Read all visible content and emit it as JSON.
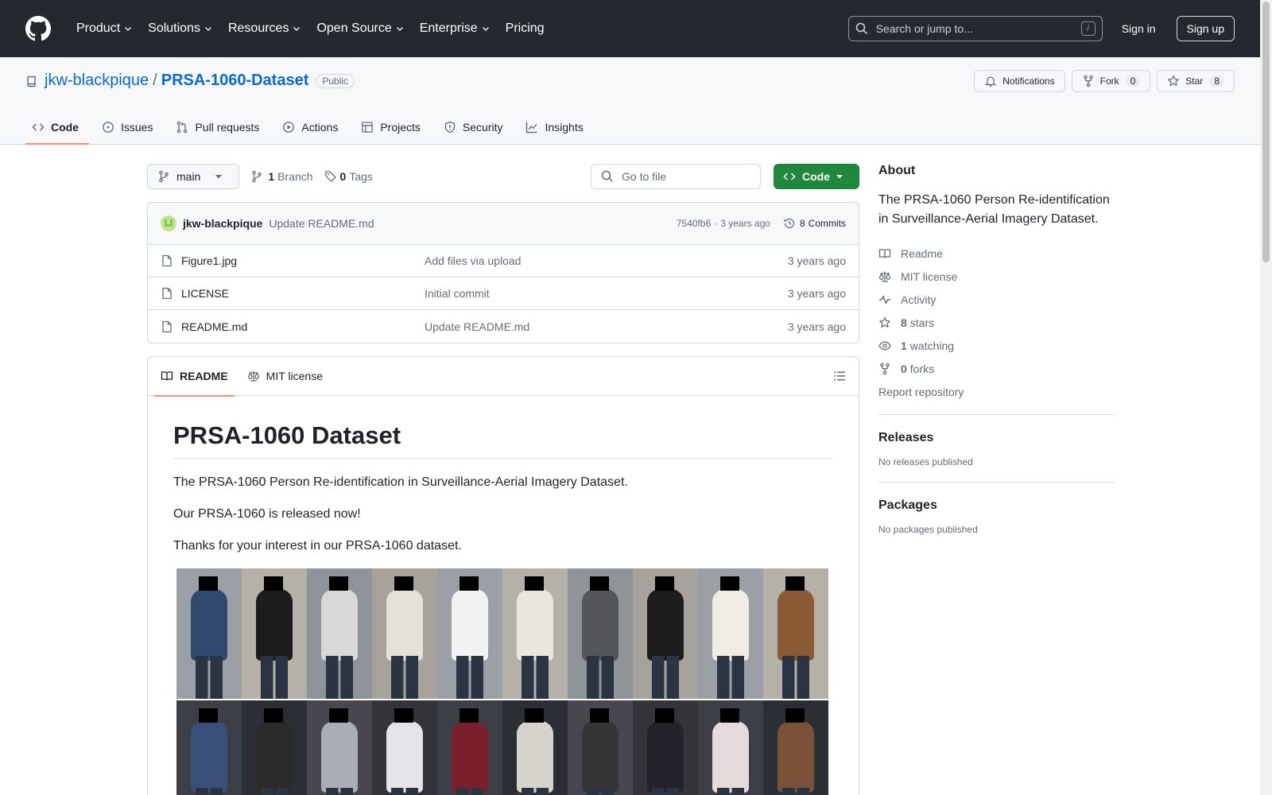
{
  "header": {
    "nav": [
      {
        "label": "Product",
        "has_caret": true
      },
      {
        "label": "Solutions",
        "has_caret": true
      },
      {
        "label": "Resources",
        "has_caret": true
      },
      {
        "label": "Open Source",
        "has_caret": true
      },
      {
        "label": "Enterprise",
        "has_caret": true
      },
      {
        "label": "Pricing",
        "has_caret": false
      }
    ],
    "search_placeholder": "Search or jump to...",
    "search_shortcut": "/",
    "signin_label": "Sign in",
    "signup_label": "Sign up"
  },
  "repo": {
    "owner": "jkw-blackpique",
    "separator": "/",
    "name": "PRSA-1060-Dataset",
    "visibility": "Public",
    "actions": {
      "notifications_label": "Notifications",
      "fork_label": "Fork",
      "fork_count": "0",
      "star_label": "Star",
      "star_count": "8"
    },
    "tabs": [
      {
        "label": "Code",
        "icon": "code-icon",
        "selected": true
      },
      {
        "label": "Issues",
        "icon": "issue-icon",
        "selected": false
      },
      {
        "label": "Pull requests",
        "icon": "pull-request-icon",
        "selected": false
      },
      {
        "label": "Actions",
        "icon": "play-icon",
        "selected": false
      },
      {
        "label": "Projects",
        "icon": "table-icon",
        "selected": false
      },
      {
        "label": "Security",
        "icon": "shield-icon",
        "selected": false
      },
      {
        "label": "Insights",
        "icon": "graph-icon",
        "selected": false
      }
    ]
  },
  "file_nav": {
    "branch": "main",
    "branch_count": "1",
    "branch_label": "Branch",
    "tag_count": "0",
    "tag_label": "Tags",
    "goto_placeholder": "Go to file",
    "code_label": "Code"
  },
  "latest_commit": {
    "author": "jkw-blackpique",
    "message": "Update README.md",
    "sha": "7540fb6",
    "dot": "·",
    "age": "3 years ago",
    "commits_count": "8",
    "commits_label": "Commits"
  },
  "files": [
    {
      "name": "Figure1.jpg",
      "commit": "Add files via upload",
      "age": "3 years ago"
    },
    {
      "name": "LICENSE",
      "commit": "Initial commit",
      "age": "3 years ago"
    },
    {
      "name": "README.md",
      "commit": "Update README.md",
      "age": "3 years ago"
    }
  ],
  "readme": {
    "tab_readme": "README",
    "tab_license": "MIT license",
    "title": "PRSA-1060 Dataset",
    "paragraphs": [
      "The PRSA-1060 Person Re-identification in Surveillance-Aerial Imagery Dataset.",
      "Our PRSA-1060 is released now!",
      "Thanks for your interest in our PRSA-1060 dataset."
    ],
    "figure_palette": {
      "top": [
        "#2f4a6e",
        "#1c1c1c",
        "#d8d8d8",
        "#e6e1d8",
        "#f2f2f2",
        "#ebe6dc",
        "#55565a",
        "#1d1d1d",
        "#f0ece4",
        "#8a5a34"
      ],
      "bottom": [
        "#3a4f7a",
        "#2a2a2a",
        "#a9adb5",
        "#e4e4ea",
        "#7a1f2b",
        "#d6d2cc",
        "#353535",
        "#22222a",
        "#e7dadc",
        "#7a5038"
      ]
    }
  },
  "sidebar": {
    "about_heading": "About",
    "about_description": "The PRSA-1060 Person Re-identification in Surveillance-Aerial Imagery Dataset.",
    "links": [
      {
        "icon": "book-icon",
        "count": "",
        "label": "Readme"
      },
      {
        "icon": "law-icon",
        "count": "",
        "label": "MIT license"
      },
      {
        "icon": "pulse-icon",
        "count": "",
        "label": "Activity"
      },
      {
        "icon": "star-icon",
        "count": "8",
        "label": "stars"
      },
      {
        "icon": "eye-icon",
        "count": "1",
        "label": "watching"
      },
      {
        "icon": "fork-icon",
        "count": "0",
        "label": "forks"
      }
    ],
    "report_label": "Report repository",
    "releases_heading": "Releases",
    "releases_empty": "No releases published",
    "packages_heading": "Packages",
    "packages_empty": "No packages published"
  }
}
